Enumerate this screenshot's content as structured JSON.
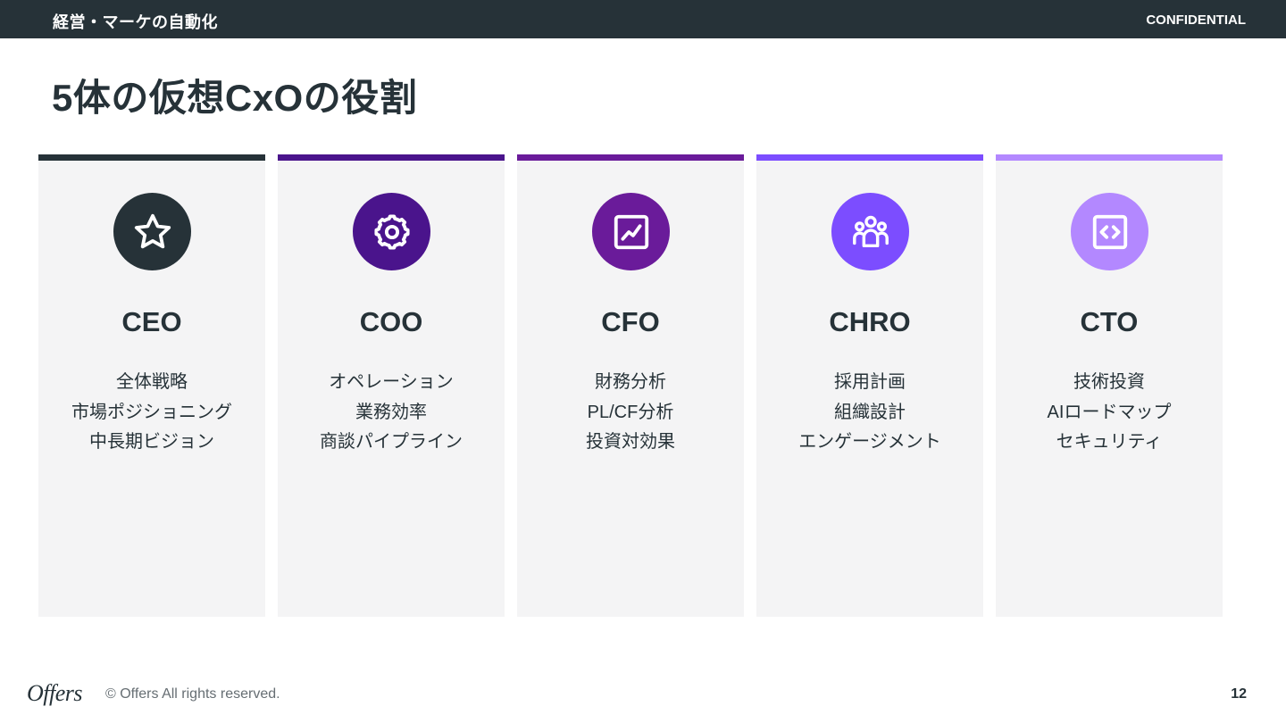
{
  "header": {
    "section": "経営・マーケの自動化",
    "confidential": "CONFIDENTIAL"
  },
  "title": "5体の仮想CxOの役割",
  "cards": [
    {
      "role": "CEO",
      "icon": "star-icon",
      "color": "#263238",
      "duties": [
        "全体戦略",
        "市場ポジショニング",
        "中長期ビジョン"
      ]
    },
    {
      "role": "COO",
      "icon": "gear-icon",
      "color": "#4a148c",
      "duties": [
        "オペレーション",
        "業務効率",
        "商談パイプライン"
      ]
    },
    {
      "role": "CFO",
      "icon": "chart-icon",
      "color": "#6a1b9a",
      "duties": [
        "財務分析",
        "PL/CF分析",
        "投資対効果"
      ]
    },
    {
      "role": "CHRO",
      "icon": "people-icon",
      "color": "#7c4dff",
      "duties": [
        "採用計画",
        "組織設計",
        "エンゲージメント"
      ]
    },
    {
      "role": "CTO",
      "icon": "code-icon",
      "color": "#b388ff",
      "duties": [
        "技術投資",
        "AIロードマップ",
        "セキュリティ"
      ]
    }
  ],
  "footer": {
    "logo": "Offers",
    "copyright": "© Offers All rights reserved.",
    "page": "12"
  }
}
